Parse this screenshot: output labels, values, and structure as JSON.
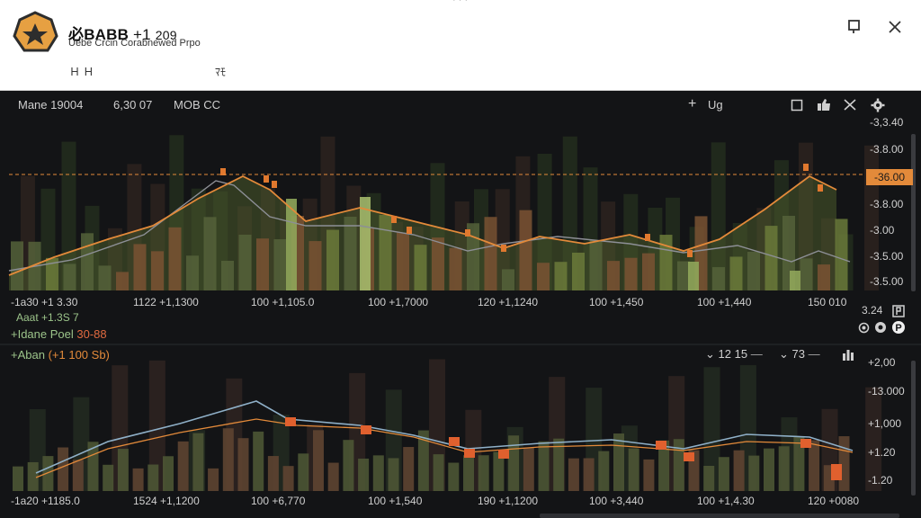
{
  "header": {
    "symbol": "必BABB",
    "change": "+1",
    "value": "209",
    "subtitle": "Uebe Crcin Corabnewed Prpo",
    "left_icons": "Ｈ Ｈ",
    "mid_icons": "ﾏﾓ",
    "top_dots": "· · ·"
  },
  "toolbar": {
    "name_label": "Mane",
    "name_value": "19004",
    "price": "6,30 07",
    "mode": "MOB CC",
    "add_label": "+",
    "ug_label": "Ug"
  },
  "main_chart": {
    "price_tag": "-36.00",
    "y_labels": [
      "-3,3.40",
      "-3.8.00",
      "-3.8.00",
      "-3.00",
      "-3.5.00",
      "-3.5.00"
    ],
    "x_labels": [
      "-1a30  +1 3.30",
      "1122  +1,1300",
      "100  +1,105.0",
      "100  +1,7000",
      "120  +1,1240",
      "100  +1,450",
      "100  +1,440",
      "150  010"
    ],
    "corner_label": "3.24"
  },
  "legend": {
    "line1": "Aaat +1.3S 7",
    "line2_name": "+Idane Poel",
    "line2_value": "30-88"
  },
  "sub_chart": {
    "title": "+Aban",
    "title_value": "(+1 100 Sb)",
    "ctrl_1": "12 15",
    "ctrl_2": "73",
    "y_labels": [
      "+2,00",
      "-13.000",
      "+1,000",
      "+1.20",
      "-1.20"
    ],
    "x_labels": [
      "-1a20  +1185.0",
      "1524  +1,1200",
      "100  +6,770",
      "100  +1,540",
      "190  +1,1200",
      "100  +3,440",
      "100  +1,4.30",
      "120  +0080"
    ]
  },
  "colors": {
    "accent_orange": "#e38a3a",
    "candle_olive": "#6b7a3a",
    "candle_brown": "#6a4a30",
    "line_grey": "#8d8f96",
    "line_blue": "#8fb0c8"
  }
}
